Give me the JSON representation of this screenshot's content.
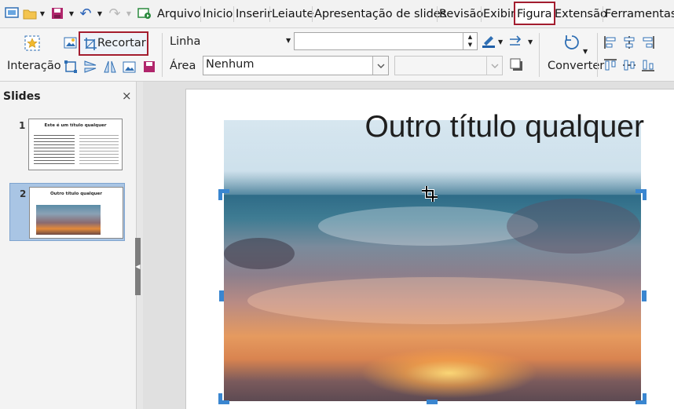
{
  "menubar": {
    "items": [
      {
        "label": "Arquivo"
      },
      {
        "label": "Inicio"
      },
      {
        "label": "Inserir"
      },
      {
        "label": "Leiaute"
      },
      {
        "label": "Apresentação de slides"
      },
      {
        "label": "Revisão"
      },
      {
        "label": "Exibir"
      },
      {
        "label": "Figura",
        "selected": true
      },
      {
        "label": "Extensão"
      },
      {
        "label": "Ferramentas"
      }
    ]
  },
  "toolbar": {
    "interaction_label": "Interação",
    "crop_label": "Recortar",
    "line_label": "Linha",
    "area_label": "Área",
    "area_fill_value": "Nenhum",
    "convert_label": "Converter"
  },
  "panel": {
    "title": "Slides",
    "close_symbol": "×",
    "slides": [
      {
        "number": "1",
        "title": "Este é um título qualquer"
      },
      {
        "number": "2",
        "title": "Outro título qualquer",
        "selected": true
      }
    ]
  },
  "slide": {
    "title": "Outro título qualquer"
  },
  "colors": {
    "accent": "#a31d2f",
    "handle": "#3a86d0",
    "selection": "#a9c5e4"
  }
}
